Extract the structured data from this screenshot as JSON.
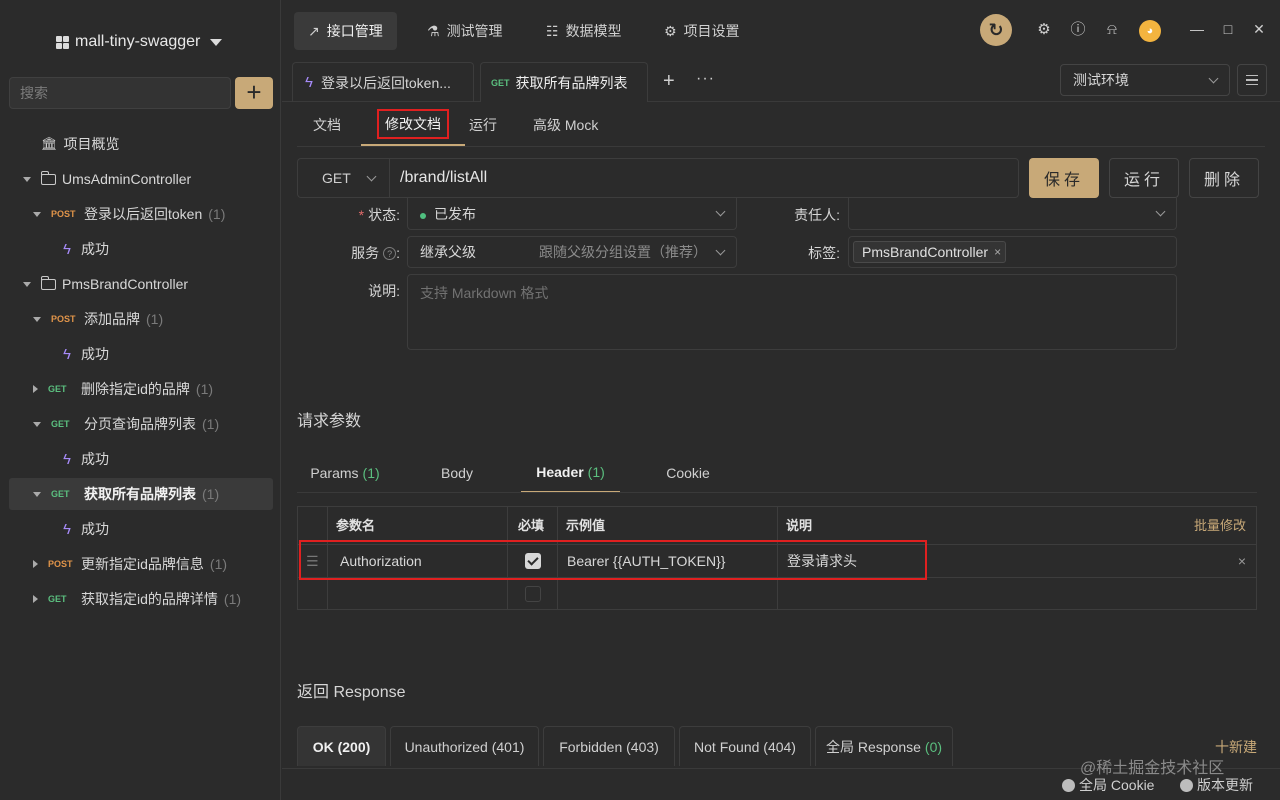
{
  "sidebar": {
    "project_name": "mall-tiny-swagger",
    "search_placeholder": "搜索",
    "add_label": "+",
    "overview": "项目概览",
    "tree": [
      {
        "type": "folder",
        "label": "UmsAdminController"
      },
      {
        "type": "api",
        "method": "POST",
        "label": "登录以后返回token",
        "count": "(1)"
      },
      {
        "type": "case",
        "label": "成功"
      },
      {
        "type": "folder",
        "label": "PmsBrandController"
      },
      {
        "type": "api",
        "method": "POST",
        "label": "添加品牌",
        "count": "(1)"
      },
      {
        "type": "case",
        "label": "成功"
      },
      {
        "type": "api",
        "method": "GET",
        "label": "删除指定id的品牌",
        "count": "(1)"
      },
      {
        "type": "api",
        "method": "GET",
        "label": "分页查询品牌列表",
        "count": "(1)"
      },
      {
        "type": "case",
        "label": "成功"
      },
      {
        "type": "api",
        "method": "GET",
        "label": "获取所有品牌列表",
        "count": "(1)",
        "active": true
      },
      {
        "type": "case",
        "label": "成功"
      },
      {
        "type": "api",
        "method": "POST",
        "label": "更新指定id品牌信息",
        "count": "(1)"
      },
      {
        "type": "api",
        "method": "GET",
        "label": "获取指定id的品牌详情",
        "count": "(1)"
      }
    ]
  },
  "topnav": {
    "tabs": [
      "接口管理",
      "测试管理",
      "数据模型",
      "项目设置"
    ],
    "active_index": 0
  },
  "icons": {
    "sync": "sync-icon",
    "settings": "gear-icon",
    "help": "help-icon",
    "notify": "bell-icon",
    "avatar": "avatar-icon"
  },
  "doc_tabs": {
    "tab1_label": "登录以后返回token...",
    "tab2_method": "GET",
    "tab2_label": "获取所有品牌列表",
    "add": "+",
    "more": "···"
  },
  "environment": {
    "selected": "测试环境"
  },
  "sub_tabs": [
    "文档",
    "修改文档",
    "运行",
    "高级 Mock"
  ],
  "request": {
    "method": "GET",
    "url": "/brand/listAll",
    "save_label": "保存",
    "run_label": "运行",
    "delete_label": "删除"
  },
  "form": {
    "status_label": "状态:",
    "status_required": "*",
    "status_value": "已发布",
    "owner_label": "责任人:",
    "owner_value": "",
    "service_label": "服务",
    "service_value": "继承父级",
    "service_hint": "跟随父级分组设置（推荐）",
    "service_help": "?",
    "tags_label": "标签:",
    "tag_value": "PmsBrandController",
    "tag_remove": "×",
    "desc_label": "说明:",
    "desc_placeholder": "支持 Markdown 格式"
  },
  "params": {
    "section_title": "请求参数",
    "tabs": [
      {
        "label": "Params",
        "count": "(1)"
      },
      {
        "label": "Body",
        "count": ""
      },
      {
        "label": "Header",
        "count": "(1)"
      },
      {
        "label": "Cookie",
        "count": ""
      }
    ],
    "active_index": 2,
    "columns": [
      "参数名",
      "必填",
      "示例值",
      "说明"
    ],
    "bulk_edit": "批量修改",
    "rows": [
      {
        "name": "Authorization",
        "required": true,
        "example": "Bearer {{AUTH_TOKEN}}",
        "desc": "登录请求头",
        "remove": "×"
      }
    ]
  },
  "response": {
    "section_title": "返回 Response",
    "tabs": [
      {
        "label": "OK (200)"
      },
      {
        "label": "Unauthorized (401)"
      },
      {
        "label": "Forbidden (403)"
      },
      {
        "label": "Not Found (404)"
      },
      {
        "label": "全局 Response",
        "count": "(0)"
      }
    ],
    "new_label": "十新建"
  },
  "statusbar": {
    "cookie_label": "全局 Cookie",
    "update_label": "版本更新",
    "watermark": "@稀土掘金技术社区"
  },
  "colors": {
    "accent": "#c8a978",
    "get": "#5bbf7f",
    "post": "#e0944a",
    "highlight": "#e02020"
  }
}
